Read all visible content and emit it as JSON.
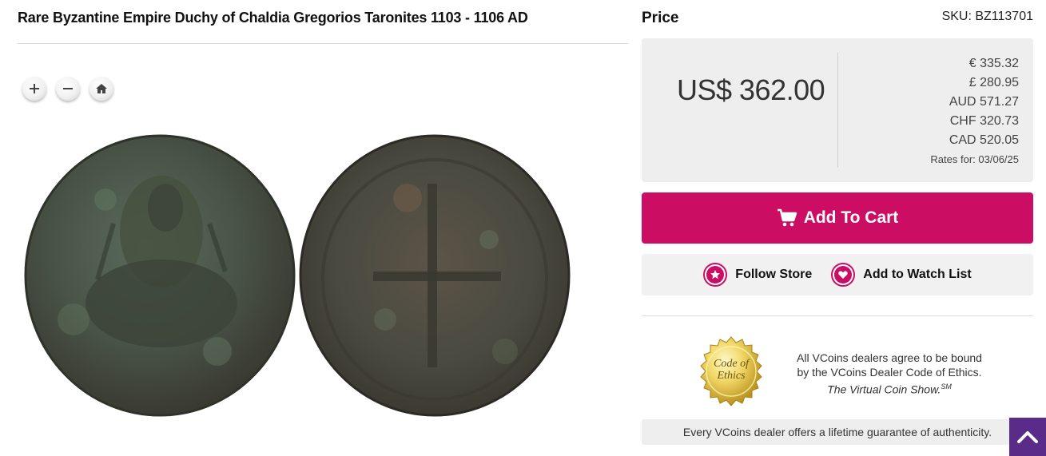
{
  "listing": {
    "title": "Rare Byzantine Empire Duchy of Chaldia Gregorios Taronites 1103 - 1106 AD"
  },
  "viewer": {
    "zoom_in_icon": "plus-icon",
    "zoom_out_icon": "minus-icon",
    "home_icon": "home-icon"
  },
  "price": {
    "label": "Price",
    "sku": "SKU: BZ113701",
    "main": "US$ 362.00",
    "conversions": [
      "€ 335.32",
      "£ 280.95",
      "AUD 571.27",
      "CHF 320.73",
      "CAD 520.05"
    ],
    "rates_date": "Rates for: 03/06/25"
  },
  "actions": {
    "add_to_cart": "Add To Cart",
    "follow_store": "Follow Store",
    "watch_list": "Add to Watch List"
  },
  "ethics": {
    "seal_line1": "Code of",
    "seal_line2": "Ethics",
    "line1": "All VCoins dealers agree to be bound",
    "line2": "by the VCoins Dealer Code of Ethics.",
    "line3": "The Virtual Coin Show.",
    "line3_mark": "SM"
  },
  "guarantee": "Every VCoins dealer offers a lifetime guarantee of authenticity.",
  "colors": {
    "accent": "#cc0d64",
    "scroll_top": "#5b2b8a",
    "panel": "#eeeeee"
  }
}
